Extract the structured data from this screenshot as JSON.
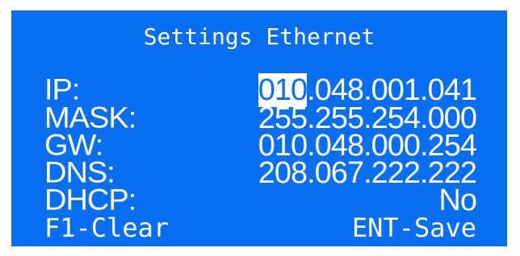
{
  "screen": {
    "title": "Settings Ethernet",
    "background_color": "#0a6ef0",
    "text_color": "#ffffff"
  },
  "fields": {
    "ip": {
      "label": "IP:",
      "value_cursor": "010",
      "value_rest": ".048.001.041"
    },
    "mask": {
      "label": "MASK:",
      "value": "255.255.254.000"
    },
    "gw": {
      "label": "GW:",
      "value": "010.048.000.254"
    },
    "dns": {
      "label": "DNS:",
      "value": "208.067.222.222"
    },
    "dhcp": {
      "label": "DHCP:",
      "value": "No"
    }
  },
  "footer": {
    "left": "F1-Clear",
    "right": "ENT-Save"
  }
}
